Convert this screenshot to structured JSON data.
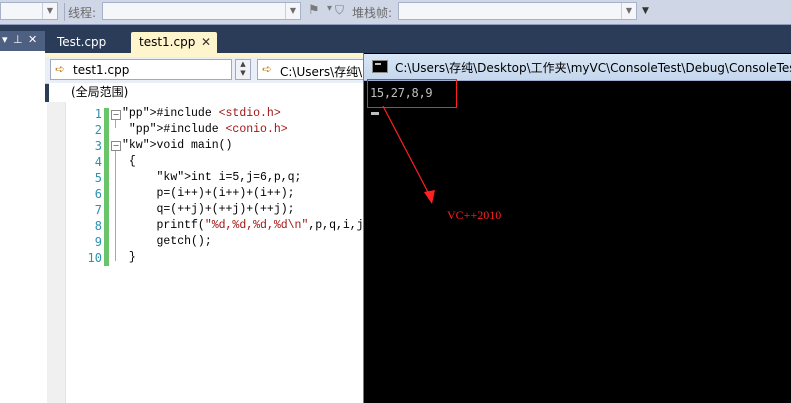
{
  "toolbar": {
    "thread_label": "线程:",
    "stack_frame_label": "堆栈帧:"
  },
  "left_panel": {
    "pin_glyph": "▾",
    "pin2_glyph": "ᵖ",
    "close_glyph": "✕"
  },
  "tabs": [
    {
      "label": "Test.cpp"
    },
    {
      "label": "test1.cpp",
      "close": "✕"
    }
  ],
  "nav": {
    "file": "test1.cpp",
    "path": "C:\\Users\\存纯\\",
    "scope": "(全局范围)"
  },
  "code": {
    "line_numbers": [
      "1",
      "2",
      "3",
      "4",
      "5",
      "6",
      "7",
      "8",
      "9",
      "10"
    ],
    "lines": [
      "#include <stdio.h>",
      " #include <conio.h>",
      "void main()",
      " {",
      "     int i=5,j=6,p,q;",
      "     p=(i++)+(i++)+(i++);",
      "     q=(++j)+(++j)+(++j);",
      "     printf(\"%d,%d,%d,%d\\n\",p,q,i,j",
      "     getch();",
      " }"
    ]
  },
  "console": {
    "title": "C:\\Users\\存纯\\Desktop\\工作夹\\myVC\\ConsoleTest\\Debug\\ConsoleTest",
    "output": "15,27,8,9"
  },
  "annotation": {
    "text": "VC++2010",
    "color": "#ff2020"
  },
  "colors": {
    "tab_active": "#fff5cc",
    "ide_frame": "#2b3c59",
    "change_bar": "#6ac46a"
  }
}
